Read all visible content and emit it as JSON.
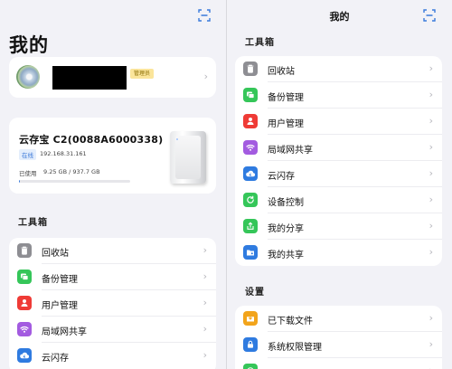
{
  "left": {
    "title": "我的",
    "profile": {
      "badge": "管理员"
    },
    "device": {
      "name": "云存宝 C2(0088A6000338)",
      "status": "在线",
      "ip": "192.168.31.161",
      "used_label": "已使用",
      "used_value": "9.25 GB / 937.7 GB",
      "usage_fraction": 0.01
    },
    "tools_title": "工具箱",
    "tools": [
      {
        "label": "回收站",
        "icon": "trash-icon",
        "color": "#8e8e93"
      },
      {
        "label": "备份管理",
        "icon": "backup-icon",
        "color": "#35c659"
      },
      {
        "label": "用户管理",
        "icon": "user-icon",
        "color": "#ef3b36"
      },
      {
        "label": "局域网共享",
        "icon": "wifi-icon",
        "color": "#a35be0"
      },
      {
        "label": "云闪存",
        "icon": "cloud-icon",
        "color": "#2f7be0"
      }
    ]
  },
  "right": {
    "nav_title": "我的",
    "tools_title": "工具箱",
    "tools": [
      {
        "label": "回收站",
        "icon": "trash-icon",
        "color": "#8e8e93"
      },
      {
        "label": "备份管理",
        "icon": "backup-icon",
        "color": "#35c659"
      },
      {
        "label": "用户管理",
        "icon": "user-icon",
        "color": "#ef3b36"
      },
      {
        "label": "局域网共享",
        "icon": "wifi-icon",
        "color": "#a35be0"
      },
      {
        "label": "云闪存",
        "icon": "cloud-icon",
        "color": "#2f7be0"
      },
      {
        "label": "设备控制",
        "icon": "device-control-icon",
        "color": "#35c659"
      },
      {
        "label": "我的分享",
        "icon": "share-icon",
        "color": "#35c659"
      },
      {
        "label": "我的共享",
        "icon": "shared-folder-icon",
        "color": "#2f7be0"
      }
    ],
    "settings_title": "设置",
    "settings": [
      {
        "label": "已下载文件",
        "icon": "download-icon",
        "color": "#f2a41b"
      },
      {
        "label": "系统权限管理",
        "icon": "lock-icon",
        "color": "#2f7be0"
      },
      {
        "label": "",
        "icon": "help-icon",
        "color": "#35c659"
      }
    ]
  },
  "icons": {
    "scan": "scan-icon",
    "chevron": "chevron-right-icon"
  }
}
